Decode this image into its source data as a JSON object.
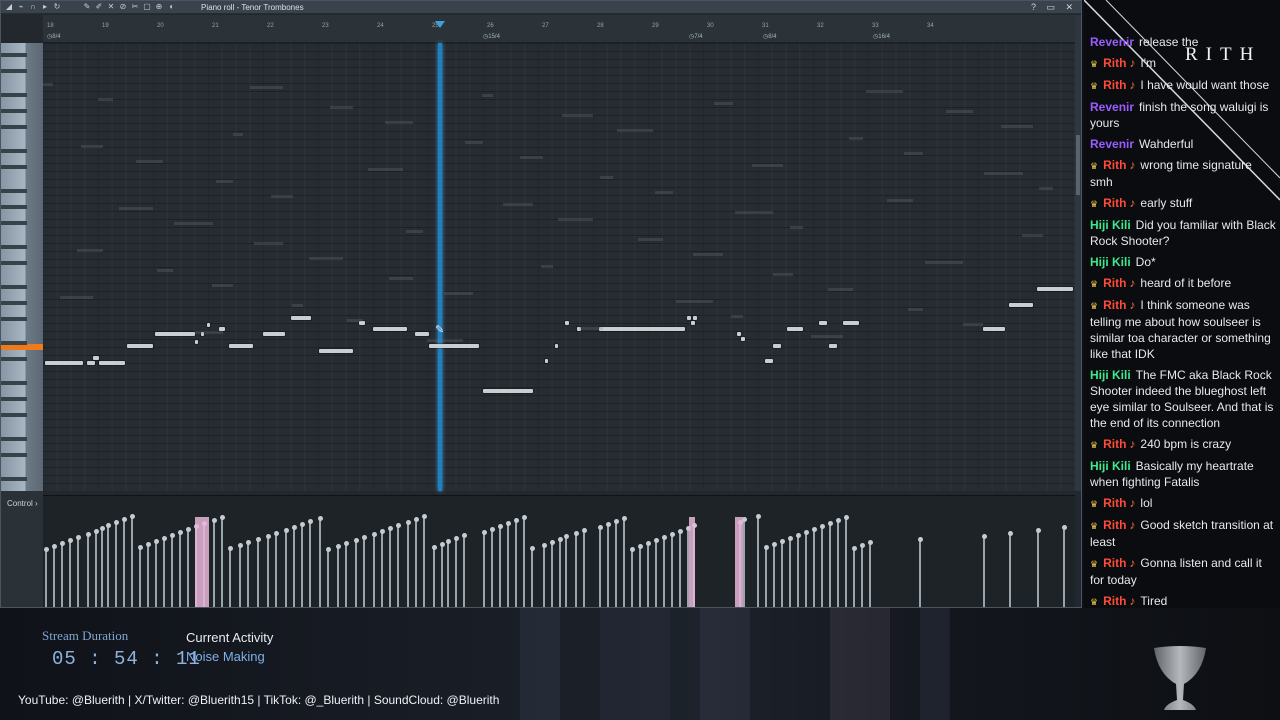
{
  "piano_roll": {
    "title": "Piano roll - Tenor Trombones",
    "window_controls": "? ▭ ✕",
    "control_label": "Control ›",
    "bar_numbers": [
      "18",
      "19",
      "20",
      "21",
      "22",
      "23",
      "24",
      "25",
      "26",
      "27",
      "28",
      "29",
      "30",
      "31",
      "32",
      "33",
      "34"
    ],
    "markers": [
      "8/4",
      "15/4",
      "7/4",
      "8/4",
      "16/4"
    ],
    "toolbar_icons": [
      "menu-icon",
      "snap-icon",
      "magnet-icon",
      "pencil-icon",
      "brush-icon",
      "delete-icon",
      "mute-icon",
      "slice-icon",
      "select-icon",
      "zoom-icon",
      "playback-icon"
    ]
  },
  "chat": {
    "brand": "RITH",
    "messages": [
      {
        "user": "Revenir",
        "color": "#9b5cff",
        "badge": false,
        "text": "release the",
        "partial": true
      },
      {
        "user": "Rith",
        "color": "#ff4b3a",
        "badge": true,
        "text": "I'm"
      },
      {
        "user": "Rith",
        "color": "#ff4b3a",
        "badge": true,
        "text": "I have would want those"
      },
      {
        "user": "Revenir",
        "color": "#9b5cff",
        "badge": false,
        "text": "finish the song waluigi is yours"
      },
      {
        "user": "Revenir",
        "color": "#9b5cff",
        "badge": false,
        "text": "Wahderful"
      },
      {
        "user": "Rith",
        "color": "#ff4b3a",
        "badge": true,
        "text": "wrong time signature smh"
      },
      {
        "user": "Rith",
        "color": "#ff4b3a",
        "badge": true,
        "text": "early stuff"
      },
      {
        "user": "Hiji Kili",
        "color": "#3ee88c",
        "badge": false,
        "text": "Did you familiar with Black Rock Shooter?"
      },
      {
        "user": "Hiji Kili",
        "color": "#3ee88c",
        "badge": false,
        "text": "Do*"
      },
      {
        "user": "Rith",
        "color": "#ff4b3a",
        "badge": true,
        "text": "heard of it before"
      },
      {
        "user": "Rith",
        "color": "#ff4b3a",
        "badge": true,
        "text": "I think someone was telling me about how soulseer is similar toa character or something like that IDK"
      },
      {
        "user": "Hiji Kili",
        "color": "#3ee88c",
        "badge": false,
        "text": "The FMC aka Black Rock Shooter indeed the blueghost left eye similar to Soulseer. And that is the end of its connection"
      },
      {
        "user": "Rith",
        "color": "#ff4b3a",
        "badge": true,
        "text": "240 bpm is crazy"
      },
      {
        "user": "Hiji Kili",
        "color": "#3ee88c",
        "badge": false,
        "text": "Basically my heartrate when fighting Fatalis"
      },
      {
        "user": "Rith",
        "color": "#ff4b3a",
        "badge": true,
        "text": "lol"
      },
      {
        "user": "Rith",
        "color": "#ff4b3a",
        "badge": true,
        "text": "Good sketch transition at least"
      },
      {
        "user": "Rith",
        "color": "#ff4b3a",
        "badge": true,
        "text": "Gonna listen and call it for today"
      },
      {
        "user": "Rith",
        "color": "#ff4b3a",
        "badge": true,
        "text": "Tired"
      }
    ]
  },
  "overlay": {
    "stream_duration_label": "Stream Duration",
    "stream_duration_value": "05 : 54 : 11",
    "current_activity_label": "Current Activity",
    "current_activity_value": "Noise Making",
    "socials": "YouTube: @Bluerith  |  X/Twitter: @Bluerith15  |  TikTok: @_Bluerith  |  SoundCloud: @Bluerith"
  },
  "colors": {
    "playhead": "#3aa0e0",
    "note": "#c9ced3",
    "key_highlight": "#f07a1a",
    "duration_text": "#8fb4dc"
  }
}
